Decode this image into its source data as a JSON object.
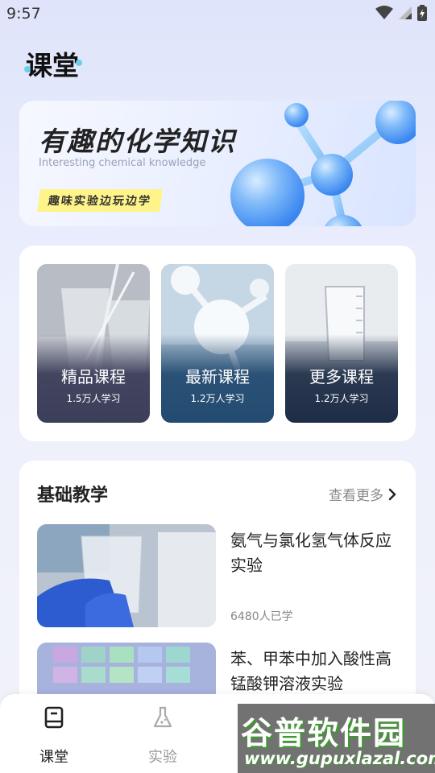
{
  "status_bar": {
    "time": "9:57",
    "icons": [
      "wifi-icon",
      "signal-icon",
      "battery-icon"
    ]
  },
  "page": {
    "title": "课堂"
  },
  "banner": {
    "title": "有趣的化学知识",
    "subtitle": "Interesting chemical knowledge",
    "tag": "趣味实验边玩边学"
  },
  "courses": [
    {
      "name": "精品课程",
      "learners": "1.5万人学习"
    },
    {
      "name": "最新课程",
      "learners": "1.2万人学习"
    },
    {
      "name": "更多课程",
      "learners": "1.2万人学习"
    }
  ],
  "basic": {
    "title": "基础教学",
    "see_more": "查看更多",
    "lessons": [
      {
        "title": "氨气与氯化氢气体反应实验",
        "learners": "6480人已学"
      },
      {
        "title": "苯、甲苯中加入酸性高锰酸钾溶液实验",
        "learners": ""
      }
    ]
  },
  "tabs": [
    {
      "label": "课堂",
      "icon": "book-icon",
      "active": true
    },
    {
      "label": "实验",
      "icon": "flask-icon",
      "active": false
    }
  ],
  "watermark": {
    "text": "谷普软件园",
    "url": "www.gupuxlazal.com"
  },
  "colors": {
    "accent": "#2f63f0",
    "tag_bg": "#fff48a",
    "active_tab": "#222222",
    "inactive_tab": "#999999"
  }
}
